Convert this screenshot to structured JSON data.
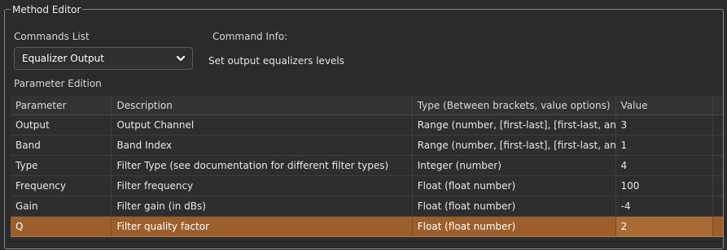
{
  "method_editor": {
    "title": "Method Editor",
    "commands_list_label": "Commands List",
    "command_info_label": "Command Info:",
    "selected_command": "Equalizer Output",
    "command_description": "Set output equalizers levels",
    "parameter_edition_label": "Parameter Edition"
  },
  "table": {
    "headers": [
      "Parameter",
      "Description",
      "Type (Between brackets, value options)",
      "Value",
      ""
    ],
    "rows": [
      {
        "parameter": "Output",
        "description": "Output Channel",
        "type": "Range (number, [first-last], [first-last, an",
        "value": "3"
      },
      {
        "parameter": "Band",
        "description": "Band Index",
        "type": "Range (number, [first-last], [first-last, an",
        "value": "1"
      },
      {
        "parameter": "Type",
        "description": "Filter Type (see documentation for different filter types)",
        "type": "Integer (number)",
        "value": "4"
      },
      {
        "parameter": "Frequency",
        "description": "Filter frequency",
        "type": "Float (float number)",
        "value": "100"
      },
      {
        "parameter": "Gain",
        "description": "Filter gain (in dBs)",
        "type": "Float (float number)",
        "value": "-4"
      },
      {
        "parameter": "Q",
        "description": "Filter quality factor",
        "type": "Float (float number)",
        "value": "2",
        "selected": true
      }
    ]
  },
  "colors": {
    "background": "#2b2b2b",
    "selected_row": "#9c5f2c",
    "border": "#8a8a8a"
  },
  "icons": {
    "dropdown": "chevron-down-icon"
  }
}
